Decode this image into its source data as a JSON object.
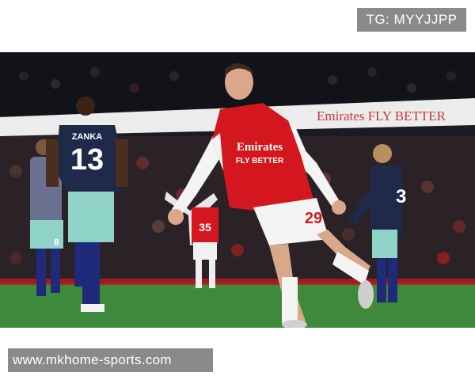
{
  "watermark": {
    "tg_label": "TG: MYYJJPP"
  },
  "footer": {
    "site_url": "www.mkhome-sports.com"
  },
  "photo": {
    "ad_board_text": "Emirates  FLY BETTER",
    "shirt_sponsor": "Emirates",
    "shirt_sponsor_line2": "FLY BETTER",
    "main_player_number": "29",
    "left_player_name": "ZANKA",
    "left_player_number": "13",
    "bg_player_number": "35",
    "left_edge_player_number": "8",
    "right_player_number": "3",
    "colors": {
      "arsenal_red": "#d4171e",
      "brentford_navy": "#1f2a4a",
      "brentford_mint": "#8fd3c8",
      "pitch_green": "#3e8a3a"
    }
  }
}
